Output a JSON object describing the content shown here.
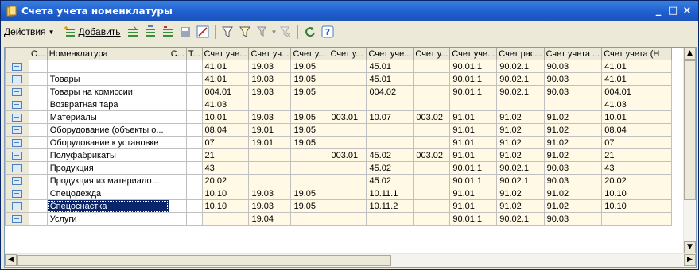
{
  "window": {
    "title": "Счета учета номенклатуры",
    "minimize": "_",
    "maximize": "□",
    "close": "×"
  },
  "toolbar": {
    "actions_label": "Действия",
    "add_label": "Добавить"
  },
  "columns": [
    "",
    "О...",
    "Номенклатура",
    "С...",
    "Т...",
    "Счет уче...",
    "Счет уч...",
    "Счет у...",
    "Счет у...",
    "Счет уче...",
    "Счет у...",
    "Счет уче...",
    "Счет рас...",
    "Счет учета ...",
    "Счет учета (Н"
  ],
  "rows": [
    {
      "name": "",
      "v": [
        "41.01",
        "19.03",
        "19.05",
        "",
        "45.01",
        "",
        "90.01.1",
        "90.02.1",
        "90.03",
        "41.01"
      ]
    },
    {
      "name": "Товары",
      "v": [
        "41.01",
        "19.03",
        "19.05",
        "",
        "45.01",
        "",
        "90.01.1",
        "90.02.1",
        "90.03",
        "41.01"
      ]
    },
    {
      "name": "Товары на комиссии",
      "v": [
        "004.01",
        "19.03",
        "19.05",
        "",
        "004.02",
        "",
        "90.01.1",
        "90.02.1",
        "90.03",
        "004.01"
      ]
    },
    {
      "name": "Возвратная тара",
      "v": [
        "41.03",
        "",
        "",
        "",
        "",
        "",
        "",
        "",
        "",
        "41.03"
      ]
    },
    {
      "name": "Материалы",
      "v": [
        "10.01",
        "19.03",
        "19.05",
        "003.01",
        "10.07",
        "003.02",
        "91.01",
        "91.02",
        "91.02",
        "10.01"
      ]
    },
    {
      "name": "Оборудование (объекты о...",
      "v": [
        "08.04",
        "19.01",
        "19.05",
        "",
        "",
        "",
        "91.01",
        "91.02",
        "91.02",
        "08.04"
      ]
    },
    {
      "name": "Оборудование к установке",
      "v": [
        "07",
        "19.01",
        "19.05",
        "",
        "",
        "",
        "91.01",
        "91.02",
        "91.02",
        "07"
      ]
    },
    {
      "name": "Полуфабрикаты",
      "v": [
        "21",
        "",
        "",
        "003.01",
        "45.02",
        "003.02",
        "91.01",
        "91.02",
        "91.02",
        "21"
      ]
    },
    {
      "name": "Продукция",
      "v": [
        "43",
        "",
        "",
        "",
        "45.02",
        "",
        "90.01.1",
        "90.02.1",
        "90.03",
        "43"
      ]
    },
    {
      "name": "Продукция из материало...",
      "v": [
        "20.02",
        "",
        "",
        "",
        "45.02",
        "",
        "90.01.1",
        "90.02.1",
        "90.03",
        "20.02"
      ]
    },
    {
      "name": "Спецодежда",
      "v": [
        "10.10",
        "19.03",
        "19.05",
        "",
        "10.11.1",
        "",
        "91.01",
        "91.02",
        "91.02",
        "10.10"
      ]
    },
    {
      "name": "Спецоснастка",
      "v": [
        "10.10",
        "19.03",
        "19.05",
        "",
        "10.11.2",
        "",
        "91.01",
        "91.02",
        "91.02",
        "10.10"
      ],
      "selected": true
    },
    {
      "name": "Услуги",
      "v": [
        "",
        "19.04",
        "",
        "",
        "",
        "",
        "90.01.1",
        "90.02.1",
        "90.03",
        ""
      ]
    }
  ]
}
